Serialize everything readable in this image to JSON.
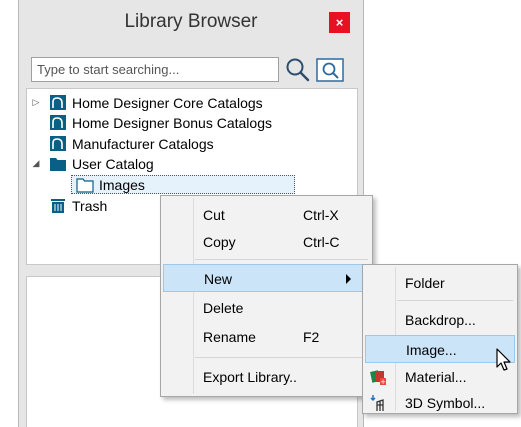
{
  "window": {
    "title": "Library Browser",
    "close_label": "×"
  },
  "search": {
    "placeholder": "Type to start searching..."
  },
  "tree": {
    "items": [
      {
        "label": "Home Designer Core Catalogs"
      },
      {
        "label": "Home Designer Bonus Catalogs"
      },
      {
        "label": "Manufacturer Catalogs"
      },
      {
        "label": "User Catalog"
      },
      {
        "label": "Images"
      },
      {
        "label": "Trash"
      }
    ]
  },
  "context_menu": {
    "cut": {
      "label": "Cut",
      "shortcut": "Ctrl-X"
    },
    "copy": {
      "label": "Copy",
      "shortcut": "Ctrl-C"
    },
    "new": {
      "label": "New"
    },
    "delete": {
      "label": "Delete"
    },
    "rename": {
      "label": "Rename",
      "shortcut": "F2"
    },
    "export": {
      "label": "Export Library.."
    }
  },
  "new_submenu": {
    "folder": "Folder",
    "backdrop": "Backdrop...",
    "image": "Image...",
    "material": "Material...",
    "symbol": "3D Symbol..."
  },
  "colors": {
    "close": "#e81123",
    "highlight": "#cce4f7",
    "highlight_border": "#99c9ef",
    "catalog_icon": "#0a5f85"
  },
  "icons": [
    "close-icon",
    "search-icon",
    "filter-search-icon",
    "catalog-icon",
    "folder-icon",
    "trash-icon",
    "submenu-arrow-icon",
    "material-icon",
    "3d-symbol-icon",
    "mouse-cursor-icon"
  ]
}
